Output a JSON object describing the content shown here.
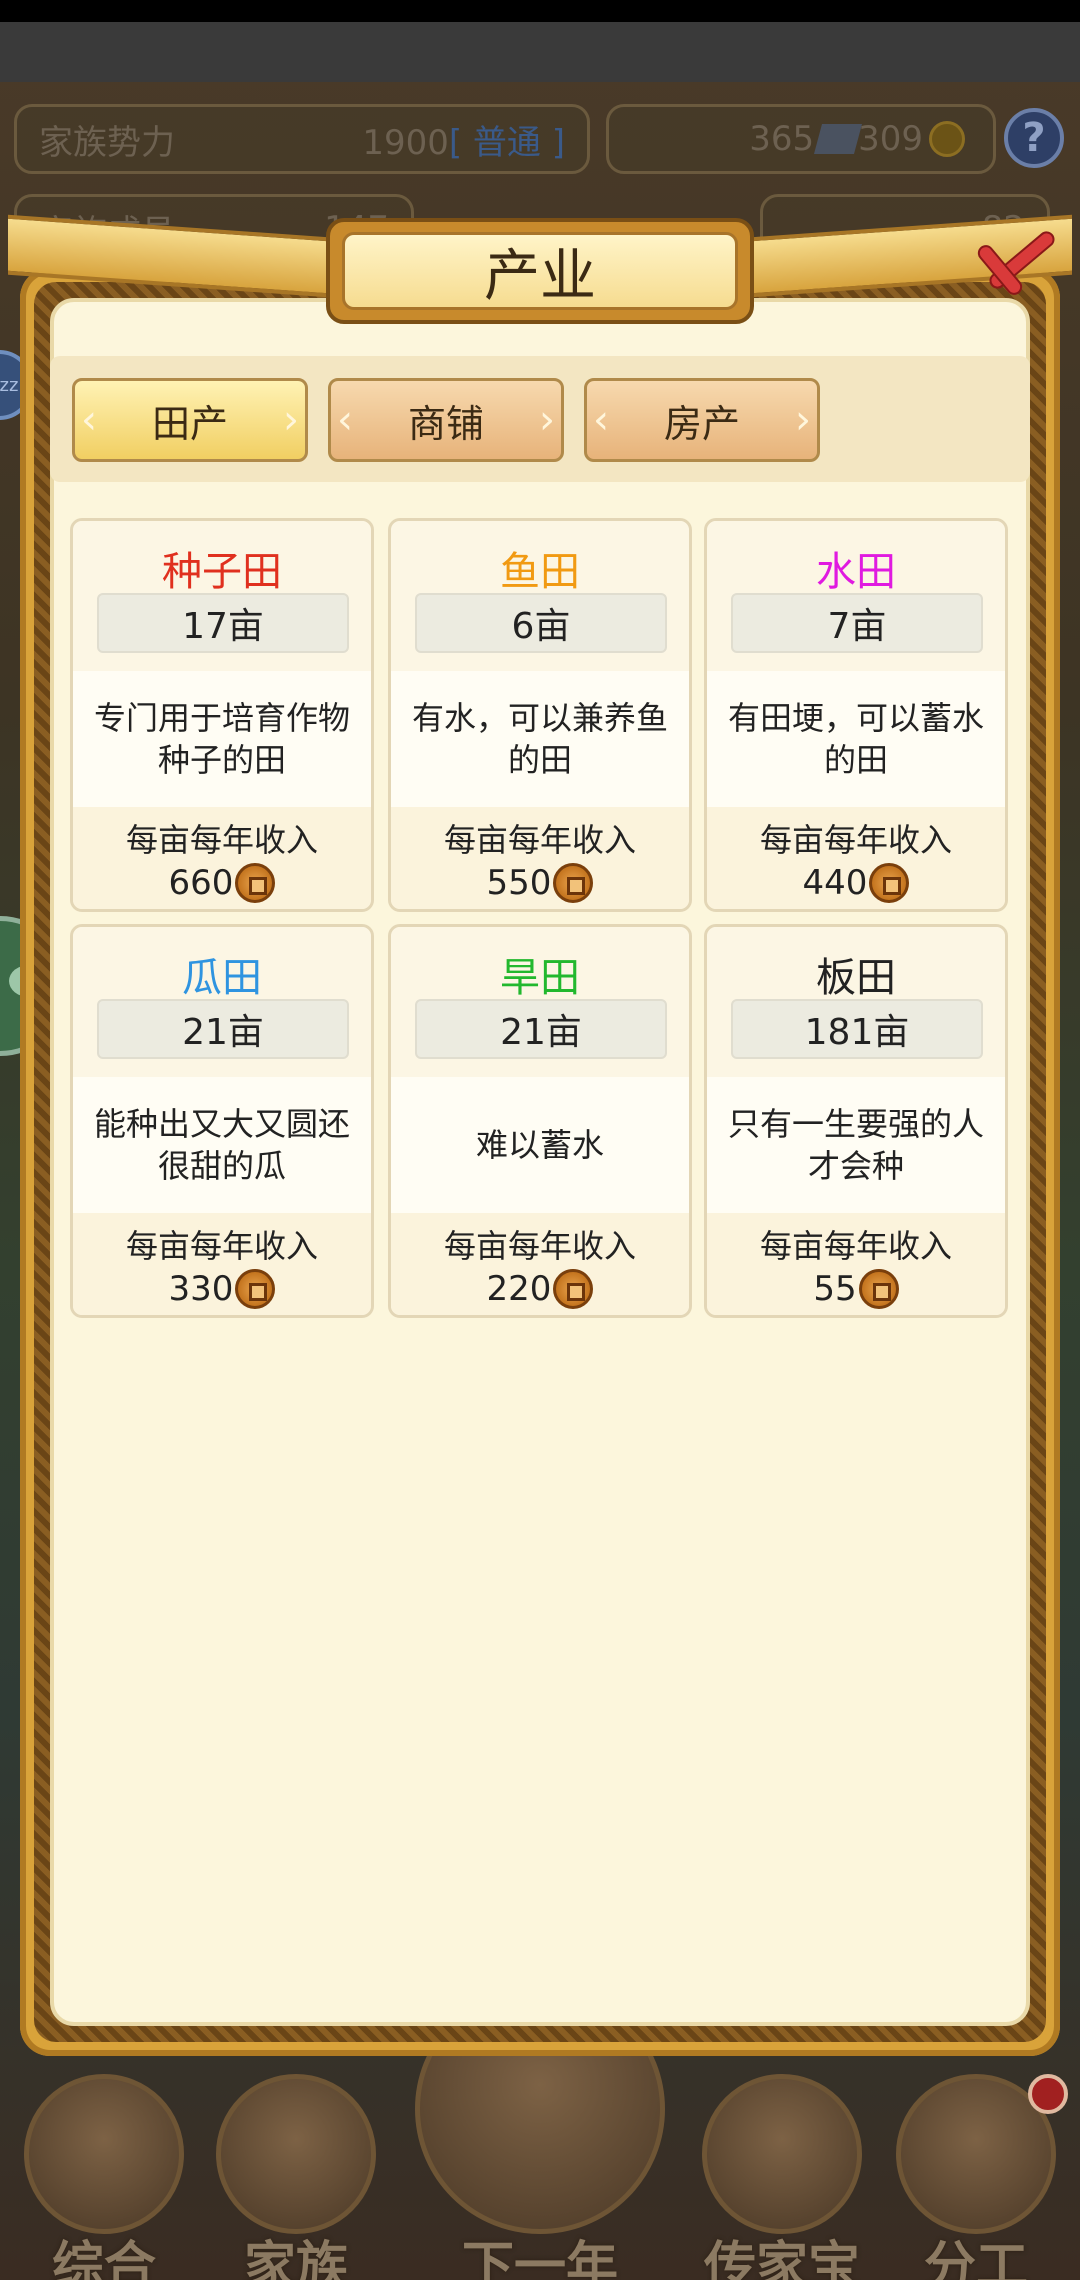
{
  "background": {
    "power_label": "家族势力",
    "power_value": "1900",
    "power_rank": "[ 普通 ]",
    "currency_1": "365",
    "currency_2": "309",
    "members_label": "家族成员",
    "members_value": "147",
    "gold_value": "82",
    "help_icon": "question-icon",
    "side_bubble_label": "zz"
  },
  "modal": {
    "title": "产业",
    "tabs": [
      {
        "label": "田产",
        "active": true
      },
      {
        "label": "商铺",
        "active": false
      },
      {
        "label": "房产",
        "active": false
      }
    ],
    "cards": [
      {
        "name": "种子田",
        "color": "#e0301e",
        "area": "17亩",
        "desc": "专门用于培育作物种子的田",
        "income_label": "每亩每年收入",
        "income": "660"
      },
      {
        "name": "鱼田",
        "color": "#f19a12",
        "area": "6亩",
        "desc": "有水，可以兼养鱼的田",
        "income_label": "每亩每年收入",
        "income": "550"
      },
      {
        "name": "水田",
        "color": "#e01ae0",
        "area": "7亩",
        "desc": "有田埂，可以蓄水的田",
        "income_label": "每亩每年收入",
        "income": "440"
      },
      {
        "name": "瓜田",
        "color": "#2f94e0",
        "area": "21亩",
        "desc": "能种出又大又圆还很甜的瓜",
        "income_label": "每亩每年收入",
        "income": "330"
      },
      {
        "name": "旱田",
        "color": "#22b82e",
        "area": "21亩",
        "desc": "难以蓄水",
        "income_label": "每亩每年收入",
        "income": "220"
      },
      {
        "name": "板田",
        "color": "#222222",
        "area": "181亩",
        "desc": "只有一生要强的人才会种",
        "income_label": "每亩每年收入",
        "income": "55"
      }
    ]
  },
  "bottom_nav": [
    {
      "label": "综合"
    },
    {
      "label": "家族"
    },
    {
      "label": "下一年"
    },
    {
      "label": "传家宝"
    },
    {
      "label": "分工"
    }
  ]
}
